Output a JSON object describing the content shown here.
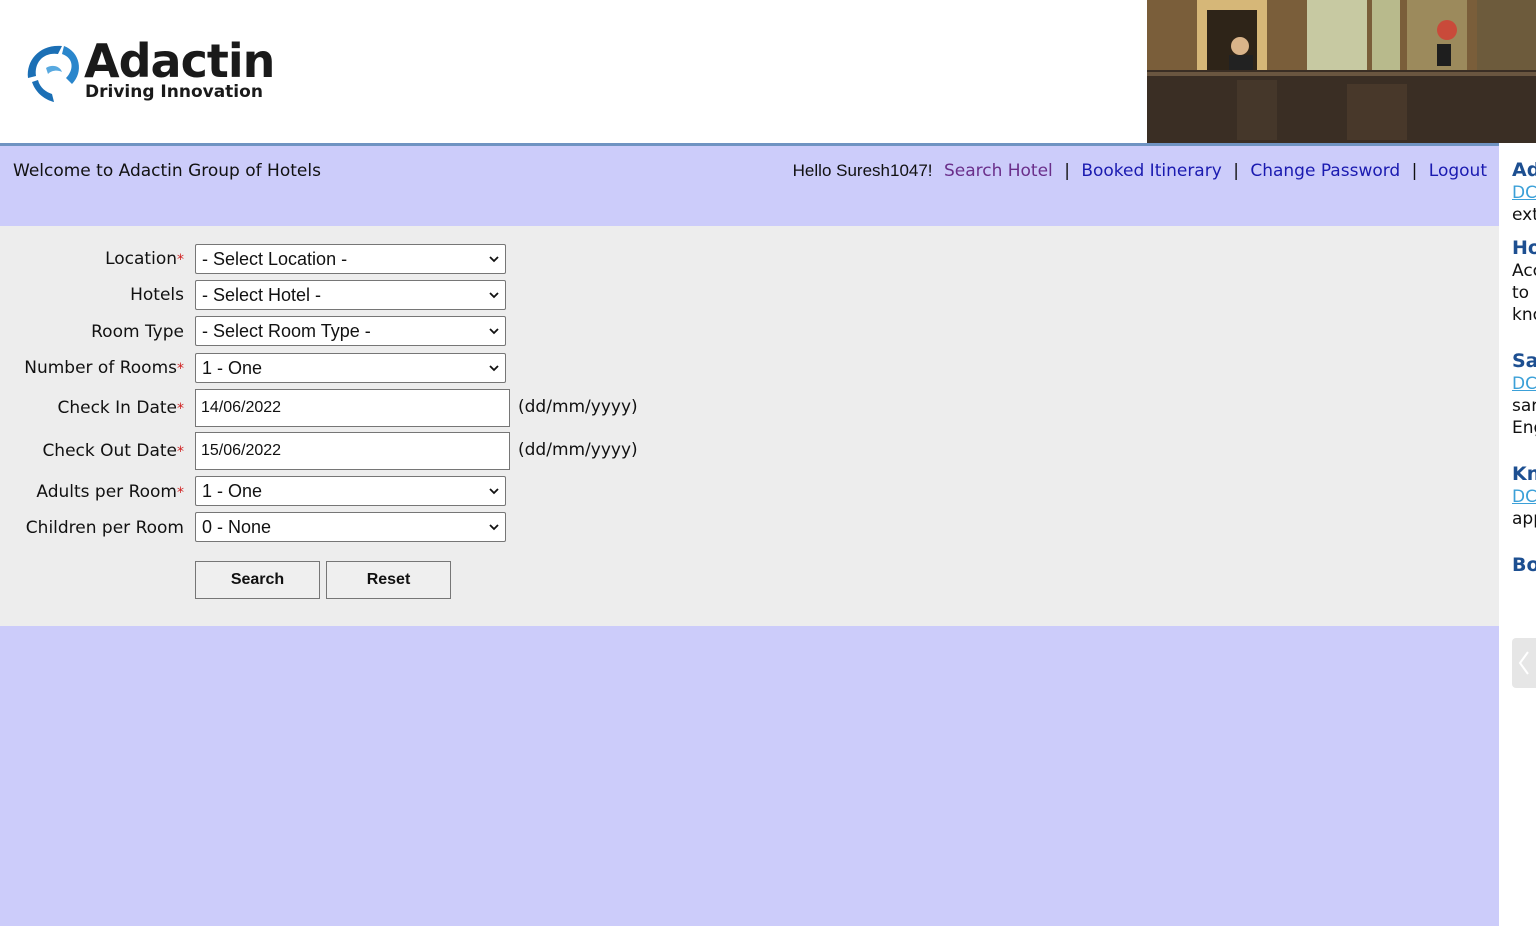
{
  "brand": {
    "name": "Adactin",
    "tagline": "Driving Innovation"
  },
  "welcome_bar": {
    "welcome_text": "Welcome to Adactin Group of Hotels",
    "greeting": "Hello Suresh1047!",
    "nav": {
      "search_hotel": "Search Hotel",
      "booked_itinerary": "Booked Itinerary",
      "change_password": "Change Password",
      "logout": "Logout",
      "separator": "|"
    }
  },
  "form": {
    "required_marker": "*",
    "location": {
      "label": "Location",
      "value": "- Select Location -"
    },
    "hotels": {
      "label": "Hotels",
      "value": "- Select Hotel -"
    },
    "room_type": {
      "label": "Room Type",
      "value": "- Select Room Type -"
    },
    "number_of_rooms": {
      "label": "Number of Rooms",
      "value": "1 - One"
    },
    "check_in": {
      "label": "Check In Date",
      "value": "14/06/2022",
      "hint": "(dd/mm/yyyy)"
    },
    "check_out": {
      "label": "Check Out Date",
      "value": "15/06/2022",
      "hint": "(dd/mm/yyyy)"
    },
    "adults": {
      "label": "Adults per Room",
      "value": "1 - One"
    },
    "children": {
      "label": "Children per Room",
      "value": "0 - None"
    },
    "search_button": "Search",
    "reset_button": "Reset"
  },
  "sidebar": {
    "items": [
      {
        "kind": "heading",
        "text": "Ad"
      },
      {
        "kind": "link",
        "text": "DC"
      },
      {
        "kind": "text",
        "text": "ext"
      },
      {
        "kind": "heading",
        "text": "Ho"
      },
      {
        "kind": "text",
        "text": "Acc"
      },
      {
        "kind": "text",
        "text": "to"
      },
      {
        "kind": "text",
        "text": "kno"
      },
      {
        "kind": "heading",
        "text": "Sa"
      },
      {
        "kind": "link",
        "text": "DC"
      },
      {
        "kind": "text",
        "text": "sar"
      },
      {
        "kind": "text",
        "text": "Eng"
      },
      {
        "kind": "heading",
        "text": "Kn"
      },
      {
        "kind": "link",
        "text": "DC"
      },
      {
        "kind": "text",
        "text": "app"
      },
      {
        "kind": "heading",
        "text": "Bo"
      }
    ]
  },
  "colors": {
    "bar_background": "#ccccfa",
    "form_background": "#ededed",
    "header_rule": "#6f93c2",
    "link": "#1a1ab0",
    "visited_link": "#6a2e8a",
    "required": "#d02020",
    "sidebar_heading": "#1d4f91",
    "sidebar_link": "#3ba0d8"
  }
}
